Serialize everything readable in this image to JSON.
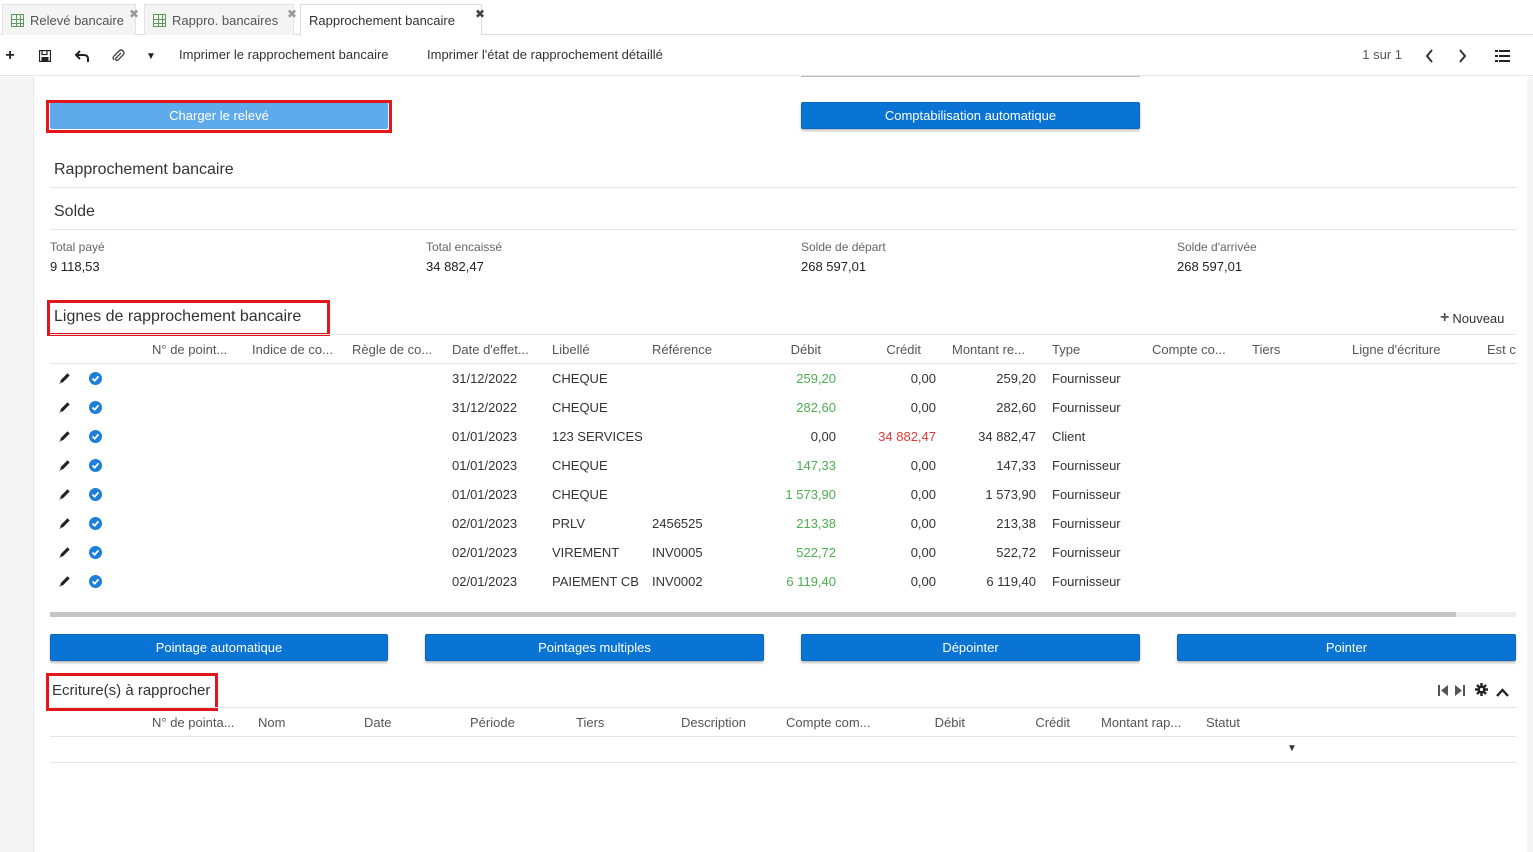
{
  "tabs": [
    {
      "label": "Relevé bancaire"
    },
    {
      "label": "Rappro. bancaires"
    },
    {
      "label": "Rapprochement bancaire"
    }
  ],
  "toolbar": {
    "print_reconciliation": "Imprimer le rapprochement bancaire",
    "print_detailed": "Imprimer l'état de rapprochement détaillé",
    "pager": "1 sur 1"
  },
  "actions": {
    "load_statement": "Charger le relevé",
    "auto_accounting": "Comptabilisation automatique"
  },
  "header": {
    "title": "Rapprochement bancaire",
    "balance_title": "Solde"
  },
  "balance": {
    "total_paid_label": "Total payé",
    "total_paid": "9 118,53",
    "total_received_label": "Total encaissé",
    "total_received": "34 882,47",
    "start_balance_label": "Solde de départ",
    "start_balance": "268 597,01",
    "end_balance_label": "Solde d'arrivée",
    "end_balance": "268 597,01"
  },
  "lines": {
    "title": "Lignes de rapprochement bancaire",
    "new_label": "Nouveau",
    "columns": [
      "N° de point...",
      "Indice de co...",
      "Règle de co...",
      "Date d'effet...",
      "Libellé",
      "Référence",
      "Débit",
      "Crédit",
      "Montant re...",
      "Type",
      "Compte co...",
      "Tiers",
      "Ligne d'écriture",
      "Est co"
    ],
    "rows": [
      {
        "date": "31/12/2022",
        "label": "CHEQUE",
        "ref": "",
        "debit": "259,20",
        "credit": "0,00",
        "amount": "259,20",
        "type": "Fournisseur"
      },
      {
        "date": "31/12/2022",
        "label": "CHEQUE",
        "ref": "",
        "debit": "282,60",
        "credit": "0,00",
        "amount": "282,60",
        "type": "Fournisseur"
      },
      {
        "date": "01/01/2023",
        "label": "123 SERVICES",
        "ref": "",
        "debit": "0,00",
        "credit": "34 882,47",
        "amount": "34 882,47",
        "type": "Client"
      },
      {
        "date": "01/01/2023",
        "label": "CHEQUE",
        "ref": "",
        "debit": "147,33",
        "credit": "0,00",
        "amount": "147,33",
        "type": "Fournisseur"
      },
      {
        "date": "01/01/2023",
        "label": "CHEQUE",
        "ref": "",
        "debit": "1 573,90",
        "credit": "0,00",
        "amount": "1 573,90",
        "type": "Fournisseur"
      },
      {
        "date": "02/01/2023",
        "label": "PRLV",
        "ref": "2456525",
        "debit": "213,38",
        "credit": "0,00",
        "amount": "213,38",
        "type": "Fournisseur"
      },
      {
        "date": "02/01/2023",
        "label": "VIREMENT",
        "ref": "INV0005",
        "debit": "522,72",
        "credit": "0,00",
        "amount": "522,72",
        "type": "Fournisseur"
      },
      {
        "date": "02/01/2023",
        "label": "PAIEMENT CB",
        "ref": "INV0002",
        "debit": "6 119,40",
        "credit": "0,00",
        "amount": "6 119,40",
        "type": "Fournisseur"
      }
    ]
  },
  "matching_buttons": {
    "auto": "Pointage automatique",
    "multiple": "Pointages multiples",
    "unmatch": "Dépointer",
    "match": "Pointer"
  },
  "entries": {
    "title": "Ecriture(s) à rapprocher",
    "columns": [
      "N° de pointa...",
      "Nom",
      "Date",
      "Période",
      "Tiers",
      "Description",
      "Compte com...",
      "Débit",
      "Crédit",
      "Montant rap...",
      "Statut"
    ]
  },
  "colors": {
    "primary": "#0a74d4",
    "highlight": "#e3161b",
    "debit": "#4caf50",
    "credit": "#e53935"
  }
}
